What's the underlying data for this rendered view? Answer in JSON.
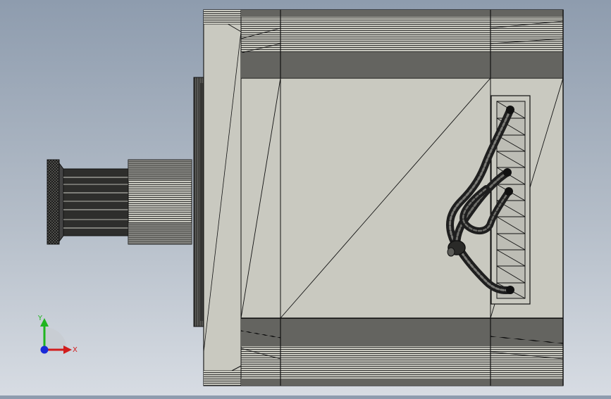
{
  "viewport": {
    "background_top": "#8e9cae",
    "background_bottom": "#d7dce3"
  },
  "model": {
    "body_color": "#c9c9c0",
    "edge_color": "#111111",
    "cable_color": "#3a3a3a"
  },
  "triad": {
    "x_label": "X",
    "y_label": "Y",
    "x_color": "#d11d1d",
    "y_color": "#1fb51f",
    "z_color": "#1a2ad8"
  }
}
